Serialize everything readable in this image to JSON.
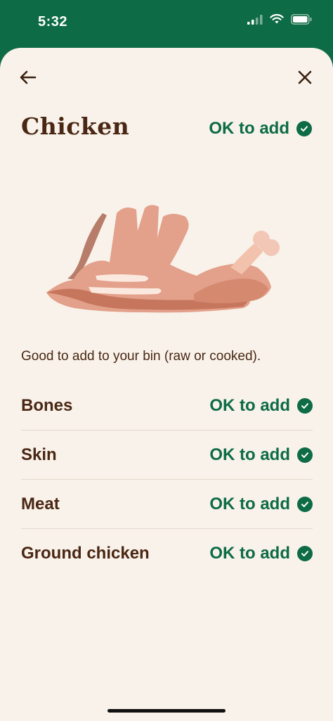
{
  "status_bar": {
    "time": "5:32",
    "icons": [
      "signal-icon",
      "wifi-icon",
      "battery-icon"
    ]
  },
  "colors": {
    "header_green": "#0d6b45",
    "sheet_bg": "#f8f2ea",
    "text_brown": "#4a2713",
    "ok_green": "#0d6b45"
  },
  "nav": {
    "back_icon": "arrow-left-icon",
    "close_icon": "close-icon"
  },
  "page": {
    "title": "Chicken",
    "status": "OK to add",
    "illustration_icon": "chicken-illustration",
    "description": "Good to add to your bin (raw or cooked)."
  },
  "items": [
    {
      "label": "Bones",
      "status": "OK to add"
    },
    {
      "label": "Skin",
      "status": "OK to add"
    },
    {
      "label": "Meat",
      "status": "OK to add"
    },
    {
      "label": "Ground chicken",
      "status": "OK to add"
    }
  ]
}
